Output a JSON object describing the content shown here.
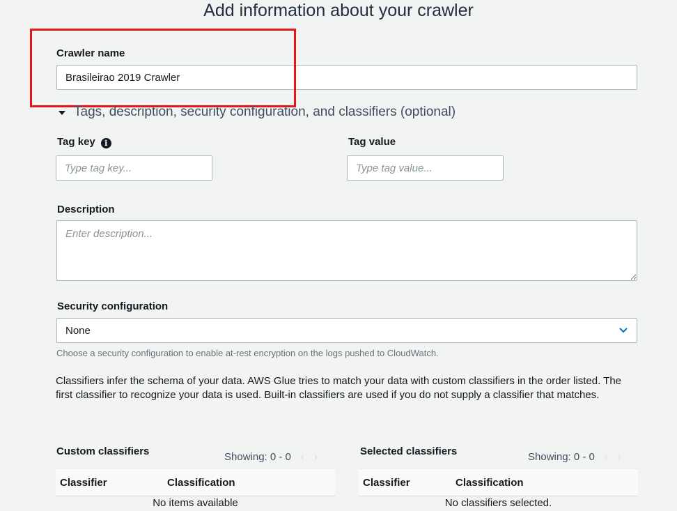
{
  "header": {
    "title": "Add information about your crawler"
  },
  "crawler_name": {
    "label": "Crawler name",
    "value": "Brasileirao 2019 Crawler"
  },
  "optional_section": {
    "label": "Tags, description, security configuration, and classifiers (optional)"
  },
  "tag_key": {
    "label": "Tag key",
    "placeholder": "Type tag key...",
    "icon": "info-icon",
    "icon_glyph": "i"
  },
  "tag_value": {
    "label": "Tag value",
    "placeholder": "Type tag value..."
  },
  "description": {
    "label": "Description",
    "placeholder": "Enter description..."
  },
  "security": {
    "label": "Security configuration",
    "selected": "None",
    "hint": "Choose a security configuration to enable at-rest encryption on the logs pushed to CloudWatch."
  },
  "classifiers_info": "Classifiers infer the schema of your data. AWS Glue tries to match your data with custom classifiers in the order listed. The first classifier to recognize your data is used. Built-in classifiers are used if you do not supply a classifier that matches.",
  "custom_classifiers": {
    "title": "Custom classifiers",
    "showing": "Showing: 0 - 0",
    "columns": [
      "Classifier",
      "Classification"
    ],
    "empty": "No items available"
  },
  "selected_classifiers": {
    "title": "Selected classifiers",
    "showing": "Showing: 0 - 0",
    "columns": [
      "Classifier",
      "Classification"
    ],
    "empty": "No classifiers selected."
  },
  "pager": {
    "prev": "‹",
    "next": "›"
  },
  "colors": {
    "highlight": "#e8141a",
    "chevron": "#0073bb"
  }
}
